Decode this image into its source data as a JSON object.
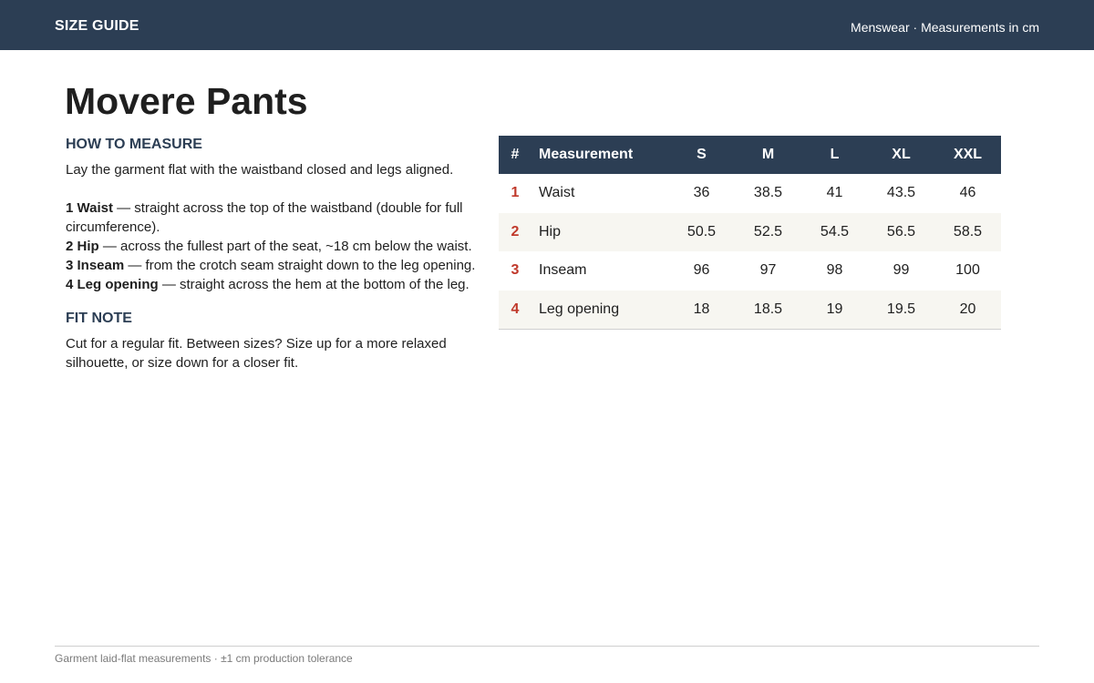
{
  "header": {
    "brand": "SIZE GUIDE",
    "meta": "Menswear · Measurements in cm"
  },
  "title": "Movere Pants",
  "how_to_measure": {
    "heading": "HOW TO MEASURE",
    "intro": "Lay the garment flat with the waistband closed and legs aligned.",
    "steps": [
      {
        "label": "1 Waist",
        "text": " — straight across the top of the waistband (double for full circumference)."
      },
      {
        "label": "2 Hip",
        "text": " — across the fullest part of the seat, ~18 cm below the waist."
      },
      {
        "label": "3 Inseam",
        "text": " — from the crotch seam straight down to the leg opening."
      },
      {
        "label": "4 Leg opening",
        "text": " — straight across the hem at the bottom of the leg."
      }
    ]
  },
  "fit_note": {
    "heading": "FIT NOTE",
    "text": "Cut for a regular fit. Between sizes? Size up for a more relaxed silhouette, or size down for a closer fit."
  },
  "table": {
    "columns": [
      "#",
      "Measurement",
      "S",
      "M",
      "L",
      "XL",
      "XXL"
    ],
    "rows": [
      [
        "1",
        "Waist",
        "36",
        "38.5",
        "41",
        "43.5",
        "46"
      ],
      [
        "2",
        "Hip",
        "50.5",
        "52.5",
        "54.5",
        "56.5",
        "58.5"
      ],
      [
        "3",
        "Inseam",
        "96",
        "97",
        "98",
        "99",
        "100"
      ],
      [
        "4",
        "Leg opening",
        "18",
        "18.5",
        "19",
        "19.5",
        "20"
      ]
    ]
  },
  "footer": "Garment laid-flat measurements · ±1 cm production tolerance",
  "colors": {
    "header_bg": "#2c3e54",
    "accent_number": "#c0392b",
    "row_stripe": "#f7f6f1"
  }
}
